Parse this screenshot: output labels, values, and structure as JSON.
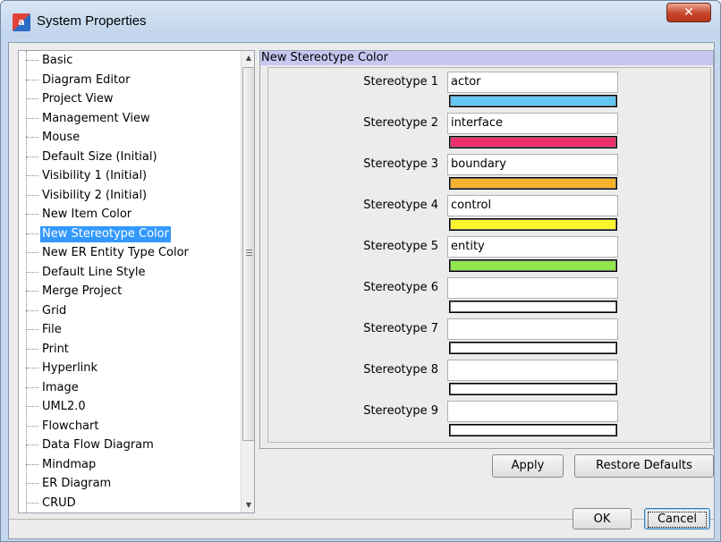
{
  "window": {
    "title": "System Properties",
    "app_icon_text": "a",
    "close_glyph": "✕"
  },
  "tree": {
    "items": [
      {
        "label": "Basic"
      },
      {
        "label": "Diagram Editor"
      },
      {
        "label": "Project View"
      },
      {
        "label": "Management View"
      },
      {
        "label": "Mouse"
      },
      {
        "label": "Default Size (Initial)"
      },
      {
        "label": "Visibility 1 (Initial)"
      },
      {
        "label": "Visibility 2 (Initial)"
      },
      {
        "label": "New Item Color"
      },
      {
        "label": "New Stereotype Color",
        "selected": true
      },
      {
        "label": "New ER Entity Type Color"
      },
      {
        "label": "Default Line Style"
      },
      {
        "label": "Merge Project"
      },
      {
        "label": "Grid"
      },
      {
        "label": "File"
      },
      {
        "label": "Print"
      },
      {
        "label": "Hyperlink"
      },
      {
        "label": "Image"
      },
      {
        "label": "UML2.0"
      },
      {
        "label": "Flowchart"
      },
      {
        "label": "Data Flow Diagram"
      },
      {
        "label": "Mindmap"
      },
      {
        "label": "ER Diagram"
      },
      {
        "label": "CRUD"
      }
    ]
  },
  "section": {
    "title": "New Stereotype Color",
    "stereotypes": [
      {
        "label": "Stereotype 1",
        "value": "actor",
        "color": "#63c6f5"
      },
      {
        "label": "Stereotype 2",
        "value": "interface",
        "color": "#ef2f6b"
      },
      {
        "label": "Stereotype 3",
        "value": "boundary",
        "color": "#f7b32b"
      },
      {
        "label": "Stereotype 4",
        "value": "control",
        "color": "#faf52c"
      },
      {
        "label": "Stereotype 5",
        "value": "entity",
        "color": "#8fe64d"
      },
      {
        "label": "Stereotype 6",
        "value": "",
        "color": "#ffffff"
      },
      {
        "label": "Stereotype 7",
        "value": "",
        "color": "#ffffff"
      },
      {
        "label": "Stereotype 8",
        "value": "",
        "color": "#ffffff"
      },
      {
        "label": "Stereotype 9",
        "value": "",
        "color": "#ffffff"
      }
    ]
  },
  "buttons": {
    "apply": "Apply",
    "restore": "Restore Defaults",
    "ok": "OK",
    "cancel": "Cancel"
  },
  "icons": {
    "scroll_up": "scroll-up-arrow-icon",
    "scroll_down": "scroll-down-arrow-icon",
    "thumb_grip": "scroll-grip-icon"
  }
}
